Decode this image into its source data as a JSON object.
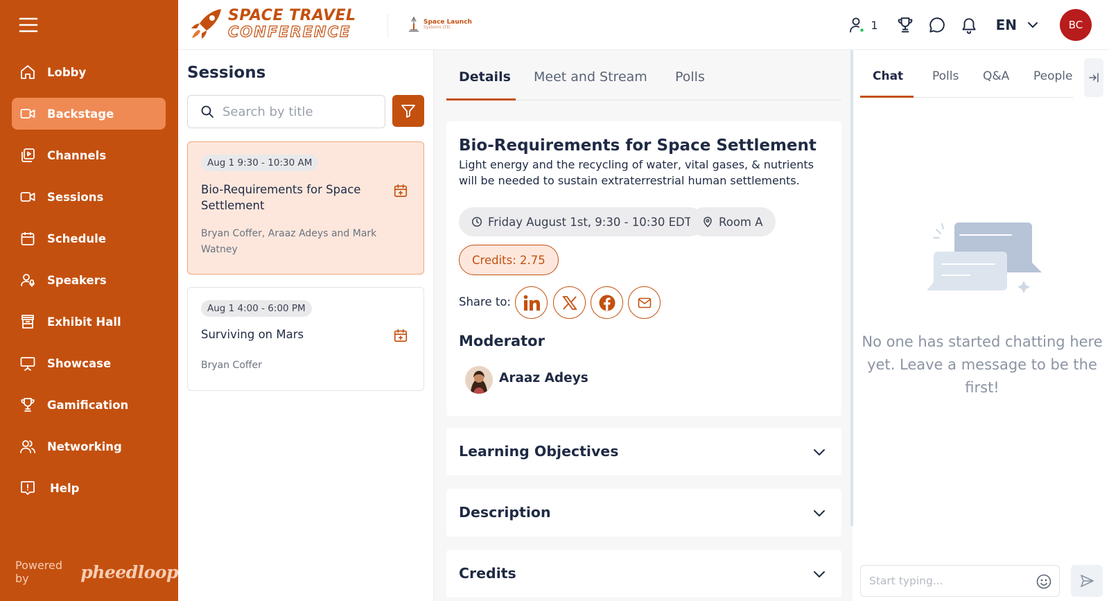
{
  "app": {
    "title": "SPACE TRAVEL CONFERENCE",
    "title_line1": "SPACE TRAVEL",
    "title_line2": "CONFERENCE"
  },
  "sponsor": {
    "line1": "Space Launch",
    "line2": "Systems LTD."
  },
  "colors": {
    "brand": "#c4500f",
    "active_nav": "#ef8a55",
    "avatar": "#b91c1c"
  },
  "sidebar": {
    "items": [
      {
        "label": "Lobby",
        "icon": "home-icon"
      },
      {
        "label": "Backstage",
        "icon": "video-camera-icon",
        "active": true
      },
      {
        "label": "Channels",
        "icon": "channels-icon"
      },
      {
        "label": "Sessions",
        "icon": "video-camera-icon"
      },
      {
        "label": "Schedule",
        "icon": "calendar-icon"
      },
      {
        "label": "Speakers",
        "icon": "speaker-icon"
      },
      {
        "label": "Exhibit Hall",
        "icon": "booth-icon"
      },
      {
        "label": "Showcase",
        "icon": "presentation-icon"
      },
      {
        "label": "Gamification",
        "icon": "trophy-icon"
      },
      {
        "label": "Networking",
        "icon": "users-icon"
      },
      {
        "label": "Help",
        "icon": "help-icon"
      }
    ],
    "powered_by": "Powered by",
    "powered_logo": "pheedloop"
  },
  "header": {
    "online_count": "1",
    "language": "EN",
    "avatar_initials": "BC"
  },
  "sessions": {
    "heading": "Sessions",
    "search_placeholder": "Search by title",
    "cards": [
      {
        "time": "Aug 1 9:30 - 10:30 AM",
        "title": "Bio-Requirements for Space Settlement",
        "speakers": "Bryan Coffer, Araaz Adeys and Mark Watney"
      },
      {
        "time": "Aug 1 4:00 - 6:00 PM",
        "title": "Surviving on Mars",
        "speakers": "Bryan Coffer"
      }
    ]
  },
  "detail": {
    "tabs": [
      "Details",
      "Meet and Stream",
      "Polls"
    ],
    "title": "Bio-Requirements for Space Settlement",
    "description": "Light energy and the recycling of water, vital gases, & nutrients will be needed to sustain extraterrestrial human settlements.",
    "datetime": "Friday August 1st, 9:30 - 10:30 EDT",
    "room": "Room A",
    "credits": "Credits: 2.75",
    "share_label": "Share to:",
    "share_icons": [
      "linkedin-icon",
      "x-icon",
      "facebook-icon",
      "email-icon"
    ],
    "moderator_heading": "Moderator",
    "moderator_name": "Araaz Adeys",
    "accordions": [
      "Learning Objectives",
      "Description",
      "Credits"
    ]
  },
  "chat": {
    "tabs": [
      "Chat",
      "Polls",
      "Q&A",
      "People"
    ],
    "empty_message": "No one has started chatting here yet. Leave a message to be the first!",
    "input_placeholder": "Start typing..."
  }
}
